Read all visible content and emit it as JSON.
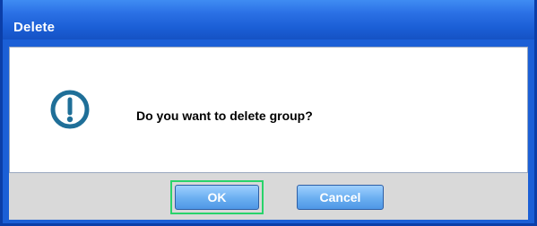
{
  "dialog": {
    "title": "Delete",
    "message": "Do you want to delete group?",
    "icon": "exclamation-circle-icon",
    "buttons": {
      "ok_label": "OK",
      "cancel_label": "Cancel"
    }
  },
  "colors": {
    "titlebar": "#1b5fd6",
    "button": "#6aaef0",
    "focus_outline": "#29d36a"
  }
}
